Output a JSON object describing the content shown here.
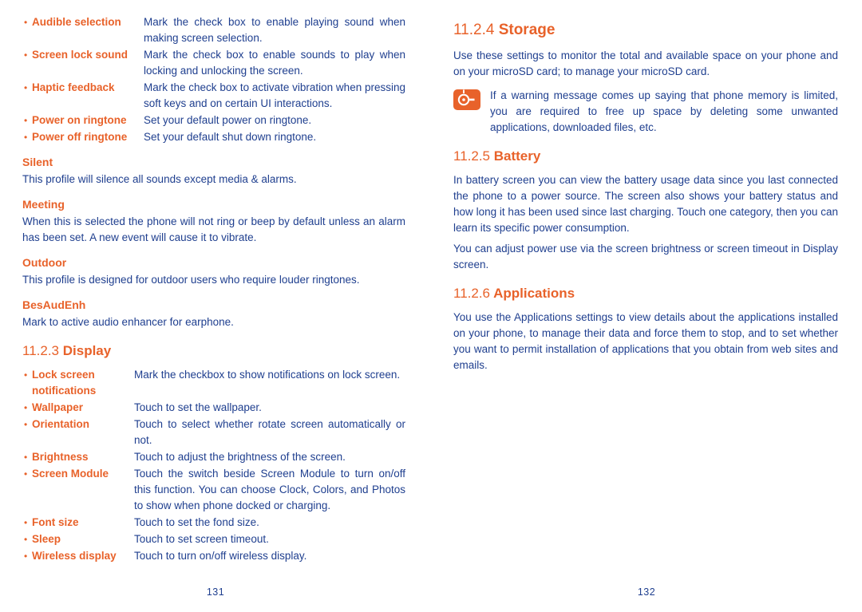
{
  "left_page": {
    "sound_settings": [
      {
        "term": "Audible selection",
        "desc": "Mark the check box to enable playing sound when making screen selection."
      },
      {
        "term": "Screen lock sound",
        "desc": "Mark the check box to enable sounds to play when locking and unlocking the screen."
      },
      {
        "term": "Haptic feedback",
        "desc": "Mark the check box to activate vibration when pressing soft keys and on certain UI interactions."
      },
      {
        "term": "Power on ringtone",
        "desc": "Set your default power on ringtone."
      },
      {
        "term": "Power off ringtone",
        "desc": "Set your default shut down ringtone."
      }
    ],
    "profiles": [
      {
        "heading": "Silent",
        "text": "This profile will silence all sounds except media & alarms."
      },
      {
        "heading": "Meeting",
        "text": "When this is selected the phone will not ring or beep by default unless an alarm has been set. A new event will cause it to vibrate."
      },
      {
        "heading": "Outdoor",
        "text": "This profile is designed for outdoor users who require louder ringtones."
      },
      {
        "heading": "BesAudEnh",
        "text": "Mark to active audio enhancer for earphone."
      }
    ],
    "display_section": {
      "number": "11.2.3",
      "title": "Display"
    },
    "display_settings": [
      {
        "term": "Lock screen notifications",
        "desc": "Mark the checkbox to show notifications on lock screen."
      },
      {
        "term": "Wallpaper",
        "desc": "Touch to set the wallpaper."
      },
      {
        "term": "Orientation",
        "desc": "Touch to select whether rotate screen automatically or not."
      },
      {
        "term": "Brightness",
        "desc": "Touch to adjust the brightness of the screen."
      },
      {
        "term": "Screen Module",
        "desc": "Touch the switch beside Screen Module to turn on/off this function. You can choose Clock, Colors, and Photos to show when phone docked or charging."
      },
      {
        "term": "Font size",
        "desc": "Touch to set the fond size."
      },
      {
        "term": "Sleep",
        "desc": "Touch to set screen timeout."
      },
      {
        "term": "Wireless display",
        "desc": "Touch to turn on/off wireless display."
      }
    ],
    "page_number": "131"
  },
  "right_page": {
    "storage_section": {
      "number": "11.2.4",
      "title": "Storage",
      "intro": "Use these settings to monitor the total and available space on your phone and on your microSD card; to manage your microSD card.",
      "note": "If a warning message comes up saying that phone memory is limited, you are required to free up space by deleting some unwanted applications, downloaded files, etc."
    },
    "battery_section": {
      "number": "11.2.5",
      "title": "Battery",
      "paragraphs": [
        "In battery screen you can view the battery usage data since you last connected the phone to a power source. The screen also shows your battery status and how long it has been used since last charging. Touch one category, then you can learn its specific power consumption.",
        "You can adjust power use via the screen brightness or screen timeout in Display screen."
      ]
    },
    "applications_section": {
      "number": "11.2.6",
      "title": "Applications",
      "paragraphs": [
        "You use the Applications settings to view details about the applications installed on your phone, to manage their data and force them to stop, and to set whether you want to permit installation of applications that you obtain from web sites and emails."
      ]
    },
    "page_number": "132"
  },
  "icons": {
    "note_icon": "tip-bulb-icon"
  },
  "colors": {
    "accent_orange": "#e8622a",
    "body_blue": "#1f3f8f"
  }
}
